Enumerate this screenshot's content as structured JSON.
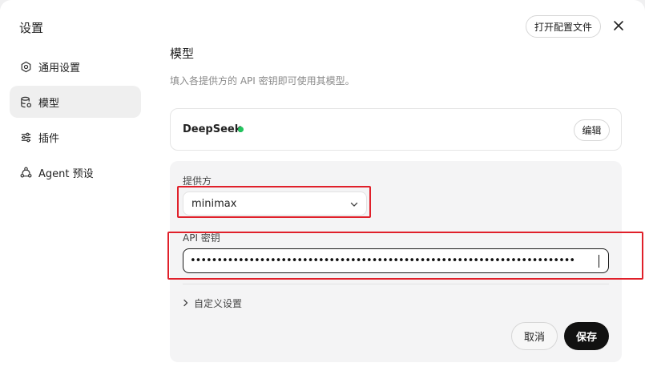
{
  "dialog": {
    "title": "设置",
    "open_config_label": "打开配置文件",
    "close_icon": "close-icon"
  },
  "sidebar": {
    "items": [
      {
        "label": "通用设置",
        "icon": "gear-icon",
        "active": false
      },
      {
        "label": "模型",
        "icon": "database-icon",
        "active": true
      },
      {
        "label": "插件",
        "icon": "sliders-icon",
        "active": false
      },
      {
        "label": "Agent 预设",
        "icon": "agent-icon",
        "active": false
      }
    ]
  },
  "main": {
    "title": "模型",
    "description": "填入各提供方的 API 密钥即可使用其模型。",
    "provider_card": {
      "name": "DeepSeek",
      "status_color": "#22c55e",
      "edit_label": "编辑"
    },
    "form": {
      "provider_label": "提供方",
      "provider_value": "minimax",
      "api_key_label": "API 密钥",
      "api_key_value": "••••••••••••••••••••••••••••••••••••••••••••••••••••••••••••••••••••••••",
      "custom_settings_label": "自定义设置",
      "cancel_label": "取消",
      "save_label": "保存"
    }
  },
  "colors": {
    "highlight": "#e0202a",
    "save_button": "#111111"
  }
}
